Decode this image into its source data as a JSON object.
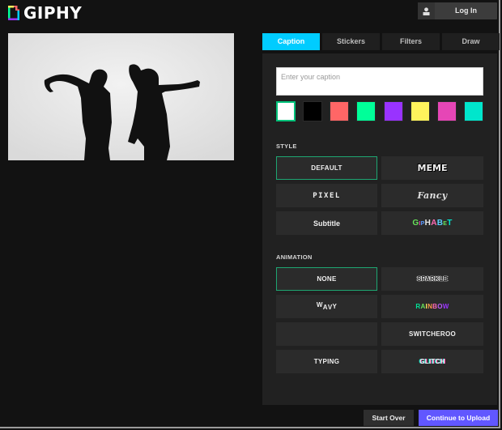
{
  "header": {
    "logo_text": "GIPHY",
    "login_label": "Log In"
  },
  "preview": {
    "description": "Black and white GIF of two dancers in silhouette"
  },
  "tabs": [
    {
      "label": "Caption",
      "active": true
    },
    {
      "label": "Stickers",
      "active": false
    },
    {
      "label": "Filters",
      "active": false
    },
    {
      "label": "Draw",
      "active": false
    }
  ],
  "caption": {
    "placeholder": "Enter your caption",
    "value": ""
  },
  "colors": {
    "selected": "#ffffff",
    "swatches": [
      "#ffffff",
      "#000000",
      "#ff6666",
      "#00ff99",
      "#9933ff",
      "#fff35c",
      "#e646b6",
      "#00e6cc"
    ],
    "accent_tab": "#00ccff",
    "accent_select": "#1ea672",
    "continue_button": "#6157ff"
  },
  "style": {
    "label": "STYLE",
    "selected": "DEFAULT",
    "options": [
      "DEFAULT",
      "MEME",
      "PIXEL",
      "Fancy",
      "Subtitle",
      "GIPHABET"
    ]
  },
  "animation": {
    "label": "ANIMATION",
    "selected": "NONE",
    "options": [
      "NONE",
      "SPARKLE",
      "WAVY",
      "RAINBOW",
      "",
      "SWITCHEROO",
      "TYPING",
      "GLITCH"
    ]
  },
  "footer": {
    "start_over": "Start Over",
    "continue": "Continue to Upload"
  }
}
